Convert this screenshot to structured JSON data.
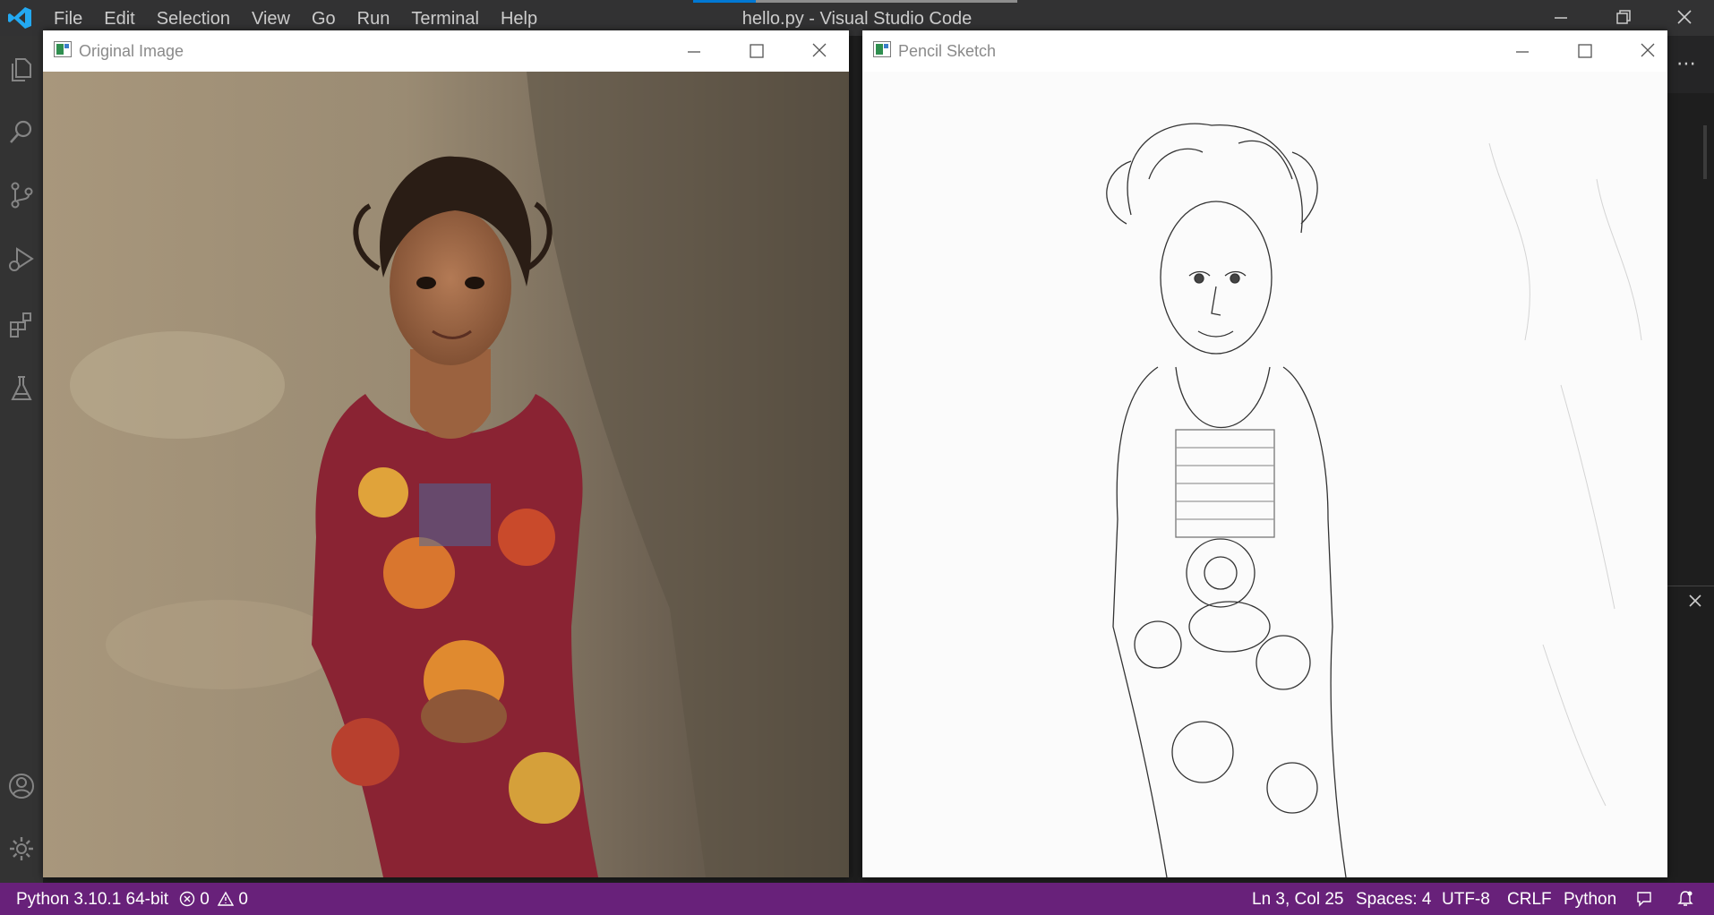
{
  "app": {
    "window_title": "hello.py - Visual Studio Code",
    "menu": [
      "File",
      "Edit",
      "Selection",
      "View",
      "Go",
      "Run",
      "Terminal",
      "Help"
    ]
  },
  "windows": [
    {
      "title": "Original Image"
    },
    {
      "title": "Pencil Sketch"
    }
  ],
  "status": {
    "interpreter": "Python 3.10.1 64-bit",
    "errors": "0",
    "warnings": "0",
    "cursor": "Ln 3, Col 25",
    "spaces": "Spaces: 4",
    "encoding": "UTF-8",
    "eol": "CRLF",
    "language": "Python"
  },
  "colors": {
    "statusbar": "#68217a",
    "titlebar": "#323233",
    "activitybar": "#333333",
    "accent": "#0078d4"
  },
  "icons": [
    "vscode-logo-icon",
    "explorer-icon",
    "search-icon",
    "source-control-icon",
    "run-debug-icon",
    "extensions-icon",
    "testing-icon",
    "account-icon",
    "manage-gear-icon"
  ]
}
